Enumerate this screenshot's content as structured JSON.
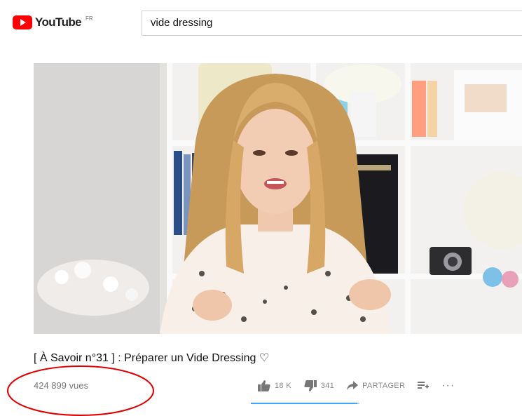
{
  "header": {
    "logo_text": "YouTube",
    "region_code": "FR",
    "search_value": "vide dressing"
  },
  "video": {
    "title": "[ À Savoir n°31 ] : Préparer un Vide Dressing ♡",
    "views": "424 899 vues",
    "likes": "18 K",
    "dislikes": "341",
    "share_label": "PARTAGER",
    "like_ratio": 0.98
  },
  "colors": {
    "brand_red": "#ff0000",
    "annotation_red": "#e00000",
    "sentiment_blue": "#3ea6ff"
  },
  "icons": {
    "logo": "youtube-play-icon",
    "like": "thumbs-up-icon",
    "dislike": "thumbs-down-icon",
    "share": "share-arrow-icon",
    "save": "add-to-playlist-icon",
    "more": "more-dots-icon"
  }
}
